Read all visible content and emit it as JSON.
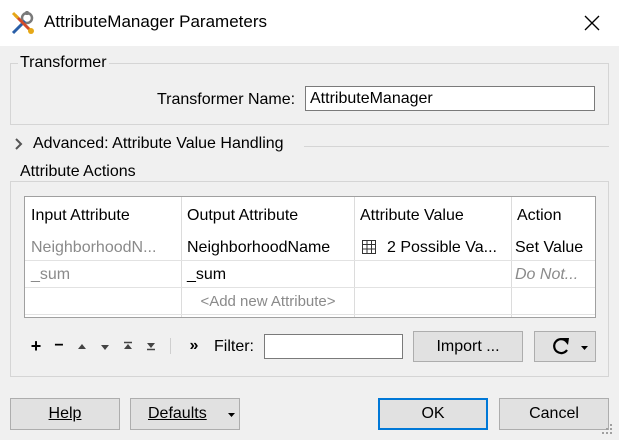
{
  "window": {
    "title": "AttributeManager Parameters"
  },
  "transformer": {
    "group_label": "Transformer",
    "name_label": "Transformer Name:",
    "name_value": "AttributeManager"
  },
  "advanced": {
    "label": "Advanced: Attribute Value Handling"
  },
  "attribute_actions": {
    "group_label": "Attribute Actions",
    "columns": [
      "Input Attribute",
      "Output Attribute",
      "Attribute Value",
      "Action"
    ],
    "rows": [
      {
        "input": "NeighborhoodN...",
        "output": "NeighborhoodName",
        "value": "2 Possible Va...",
        "value_icon": "table-icon",
        "action": "Set Value"
      },
      {
        "input": "_sum",
        "output": "_sum",
        "value": "",
        "action": "Do Not..."
      }
    ],
    "add_row_label": "<Add new Attribute>"
  },
  "toolbar": {
    "add": "+",
    "remove": "−",
    "expand": "»",
    "filter_label": "Filter:",
    "filter_value": "",
    "import_label": "Import ..."
  },
  "footer": {
    "help": "Help",
    "defaults": "Defaults",
    "ok": "OK",
    "cancel": "Cancel"
  },
  "colors": {
    "accent": "#0078d7",
    "background": "#f0f0f0"
  }
}
